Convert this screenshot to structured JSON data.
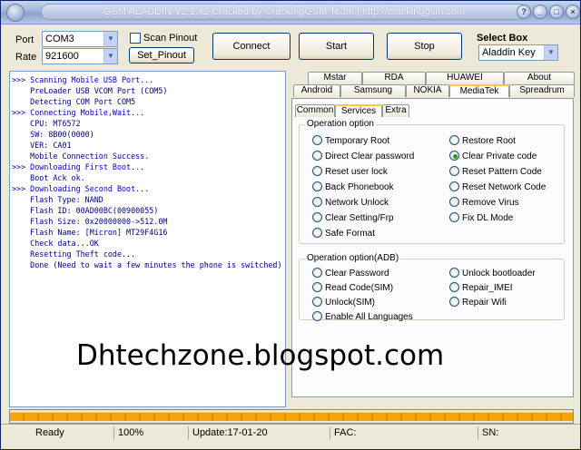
{
  "window": {
    "title": "GSM ALADDIN V2.1.42 Cracked by CrackingGSM Team | http://crackinggsm.com",
    "buttons": [
      "?",
      "_",
      "□",
      "×"
    ]
  },
  "connection": {
    "port_label": "Port",
    "port_value": "COM3",
    "rate_label": "Rate",
    "rate_value": "921600",
    "scan_pinout_label": "Scan Pinout",
    "set_pinout_label": "Set_Pinout"
  },
  "toolbar": {
    "connect_label": "Connect",
    "start_label": "Start",
    "stop_label": "Stop"
  },
  "select_box": {
    "label": "Select Box",
    "value": "Aladdin Key"
  },
  "console_lines": [
    ">>> Scanning Mobile USB Port...",
    "    PreLoader USB VCOM Port (COM5)",
    "    Detecting COM Port COM5",
    ">>> Connecting Mobile,Wait...",
    "    CPU: MT6572",
    "    SW: 8B00(0000)",
    "    VER: CA01",
    "    Mobile Connection Success.",
    ">>> Downloading First Boot...",
    "    Boot Ack ok.",
    ">>> Downloading Second Boot...",
    "    Flash Type: NAND",
    "    Flash ID: 00AD00BC(00900055)",
    "    Flash Size: 0x20000000->512.0M",
    "    Flash Name: [Micron] MT29F4G16",
    "    Check data...OK",
    "    Resetting Theft code...",
    "    Done (Need to wait a few minutes the phone is switched)"
  ],
  "tabs_row1": [
    "Mstar",
    "RDA",
    "HUAWEI",
    "About"
  ],
  "tabs_row2": [
    "Android",
    "Samsung",
    "NOKIA",
    "MediaTek",
    "Spreadrum"
  ],
  "subtabs": [
    "Common",
    "Services",
    "Extra"
  ],
  "operation_option": {
    "title": "Operation option",
    "left": [
      "Temporary Root",
      "Direct Clear password",
      "Reset user lock",
      "Back Phonebook",
      "Network Unlock",
      "Clear Setting/Frp",
      "Safe Format"
    ],
    "right": [
      "Restore Root",
      "Clear Private code",
      "Reset Pattern Code",
      "Reset Network Code",
      "Remove Virus",
      "Fix DL Mode"
    ],
    "selected": "Clear Private code"
  },
  "operation_option_adb": {
    "title": "Operation option(ADB)",
    "left": [
      "Clear Password",
      "Read Code(SIM)",
      "Unlock(SIM)",
      "Enable All Languages"
    ],
    "right": [
      "Unlock bootloader",
      "Repair_IMEI",
      "Repair Wifi"
    ]
  },
  "watermark": "Dhtechzone.blogspot.com",
  "progress_percent": 100,
  "status": {
    "ready": "Ready",
    "percent": "100%",
    "update": "Update:17-01-20",
    "fac": "FAC:",
    "sn": "SN:"
  }
}
